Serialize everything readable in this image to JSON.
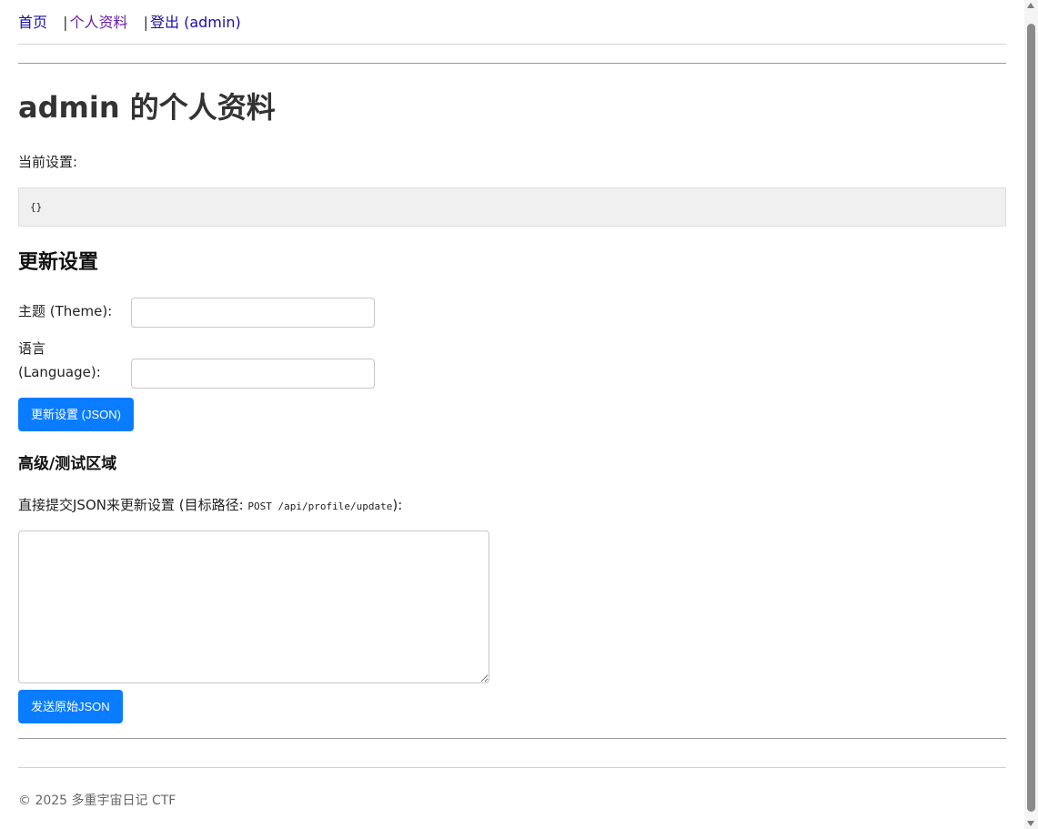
{
  "nav": {
    "home": "首页",
    "separator": "|",
    "profile": "个人资料",
    "logout": "登出 (admin)"
  },
  "page_title": "admin 的个人资料",
  "current_settings": {
    "label": "当前设置:",
    "value": "{}"
  },
  "update_section": {
    "title": "更新设置",
    "theme_label": "主题 (Theme):",
    "theme_value": "",
    "language_label_line1": "语言",
    "language_label_line2": "(Language):",
    "language_value": "",
    "submit_label": "更新设置 (JSON)"
  },
  "advanced_section": {
    "title": "高级/测试区域",
    "desc_prefix": "直接提交JSON来更新设置 (目标路径: ",
    "desc_code": "POST /api/profile/update",
    "desc_suffix": "):",
    "raw_value": "",
    "send_label": "发送原始JSON"
  },
  "footer": {
    "text": "© 2025 多重宇宙日记 CTF"
  },
  "colors": {
    "primary_button": "#0a7cff",
    "link": "#1a0dab",
    "visited_link": "#681da8",
    "settings_box_bg": "#f0f0f0"
  }
}
